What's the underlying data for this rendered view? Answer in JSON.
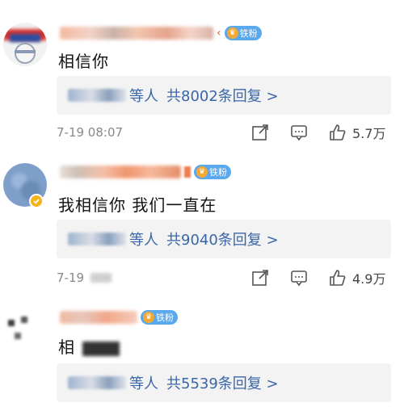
{
  "comments": [
    {
      "text": "相信你",
      "badge": "铁粉",
      "reply": {
        "suffix": "等人",
        "count_text": "共8002条回复 >"
      },
      "time": "7-19 08:07",
      "likes": "5.7万"
    },
    {
      "text": "我相信你 我们一直在",
      "badge": "铁粉",
      "reply": {
        "suffix": "等人",
        "count_text": "共9040条回复 >"
      },
      "time": "7-19",
      "likes": "4.9万"
    },
    {
      "text": "相",
      "badge": "铁粉",
      "reply": {
        "suffix": "等人",
        "count_text": "共5539条回复 >"
      }
    }
  ],
  "icons": {
    "share": "share-icon",
    "comment": "comment-icon",
    "like": "thumbs-up-icon",
    "badge": "crown-icon"
  }
}
